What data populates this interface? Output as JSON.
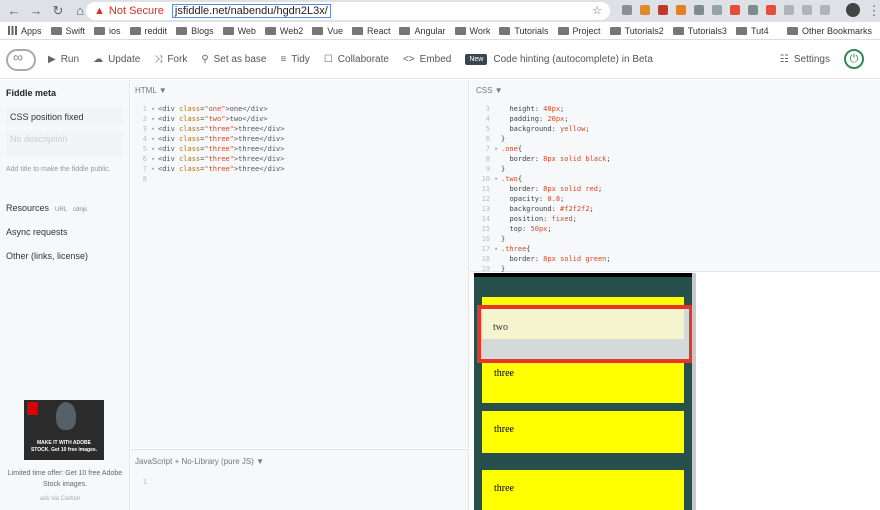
{
  "browser": {
    "security_label": "Not Secure",
    "url": "jsfiddle.net/nabendu/hgdn2L3x/",
    "bookmarks": [
      "Apps",
      "Swift",
      "ios",
      "reddit",
      "Blogs",
      "Web",
      "Web2",
      "Vue",
      "React",
      "Angular",
      "Work",
      "Tutorials",
      "Project",
      "Tutorials2",
      "Tutorials3",
      "Tut4"
    ],
    "other_bookmarks": "Other Bookmarks"
  },
  "toolbar": {
    "run": "Run",
    "update": "Update",
    "fork": "Fork",
    "set_as_base": "Set as base",
    "tidy": "Tidy",
    "collaborate": "Collaborate",
    "embed": "Embed",
    "new_badge": "New",
    "hint": "Code hinting (autocomplete) in Beta",
    "settings": "Settings"
  },
  "sidebar": {
    "heading": "Fiddle meta",
    "title": "CSS position fixed",
    "desc_placeholder": "No description",
    "note": "Add title to make the fiddle public.",
    "resources": "Resources",
    "url_tag": "URL",
    "cdnjs_tag": "cdnjs",
    "async": "Async requests",
    "other": "Other (links, license)",
    "ad_text": "MAKE IT WITH ADOBE STOCK. Get 10 free images.",
    "ad_note": "Limited time offer: Get 10 free Adobe Stock images.",
    "ad_via": "ads via Carbon"
  },
  "panels": {
    "html": "HTML ▼",
    "css": "CSS ▼",
    "js": "JavaScript + No-Library (pure JS) ▼"
  },
  "html_lines": [
    {
      "n": "1",
      "cls": "one",
      "txt": "one"
    },
    {
      "n": "2",
      "cls": "two",
      "txt": "two"
    },
    {
      "n": "3",
      "cls": "three",
      "txt": "three"
    },
    {
      "n": "4",
      "cls": "three",
      "txt": "three"
    },
    {
      "n": "5",
      "cls": "three",
      "txt": "three"
    },
    {
      "n": "6",
      "cls": "three",
      "txt": "three"
    },
    {
      "n": "7",
      "cls": "three",
      "txt": "three"
    },
    {
      "n": "8",
      "cls": "",
      "txt": ""
    }
  ],
  "css_lines": [
    {
      "n": "3",
      "kind": "decl",
      "p": "height",
      "v": "40px"
    },
    {
      "n": "4",
      "kind": "decl",
      "p": "padding",
      "v": "20px"
    },
    {
      "n": "5",
      "kind": "decl",
      "p": "background",
      "v": "yellow"
    },
    {
      "n": "6",
      "kind": "close"
    },
    {
      "n": "7",
      "kind": "sel",
      "s": ".one"
    },
    {
      "n": "8",
      "kind": "decl",
      "p": "border",
      "v": "8px solid black"
    },
    {
      "n": "9",
      "kind": "close"
    },
    {
      "n": "10",
      "kind": "sel",
      "s": ".two"
    },
    {
      "n": "11",
      "kind": "decl",
      "p": "border",
      "v": "8px solid red"
    },
    {
      "n": "12",
      "kind": "decl",
      "p": "opacity",
      "v": "0.8"
    },
    {
      "n": "13",
      "kind": "decl",
      "p": "background",
      "v": "#f2f2f2"
    },
    {
      "n": "14",
      "kind": "decl",
      "p": "position",
      "v": "fixed"
    },
    {
      "n": "15",
      "kind": "decl",
      "p": "top",
      "v": "50px"
    },
    {
      "n": "16",
      "kind": "close"
    },
    {
      "n": "17",
      "kind": "sel",
      "s": ".three"
    },
    {
      "n": "18",
      "kind": "decl",
      "p": "border",
      "v": "8px solid green"
    },
    {
      "n": "19",
      "kind": "close"
    }
  ],
  "js_line": "1",
  "result": {
    "two": "two",
    "threes": [
      "three",
      "three",
      "three"
    ]
  }
}
